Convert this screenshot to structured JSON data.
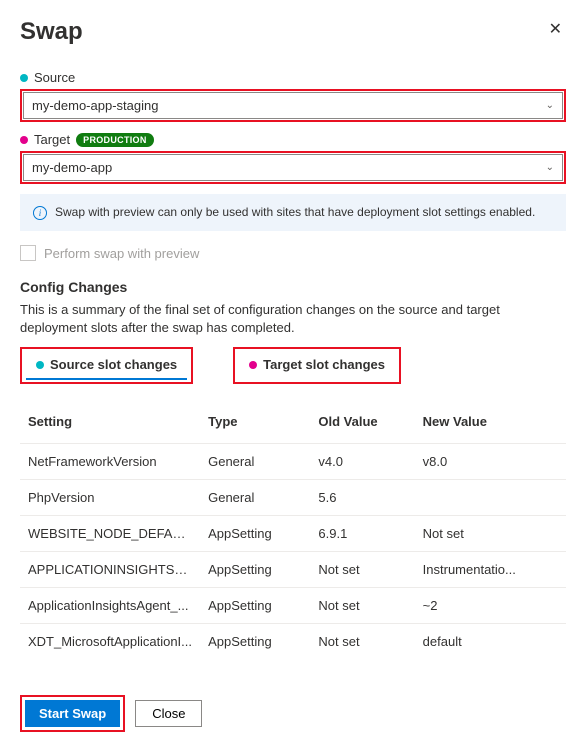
{
  "header": {
    "title": "Swap"
  },
  "source": {
    "label": "Source",
    "value": "my-demo-app-staging"
  },
  "target": {
    "label": "Target",
    "badge": "PRODUCTION",
    "value": "my-demo-app"
  },
  "info": {
    "text": "Swap with preview can only be used with sites that have deployment slot settings enabled."
  },
  "previewCheckbox": {
    "label": "Perform swap with preview"
  },
  "config": {
    "heading": "Config Changes",
    "desc": "This is a summary of the final set of configuration changes on the source and target deployment slots after the swap has completed."
  },
  "tabs": {
    "source": "Source slot changes",
    "target": "Target slot changes"
  },
  "table": {
    "headers": {
      "setting": "Setting",
      "type": "Type",
      "old": "Old Value",
      "new": "New Value"
    },
    "rows": [
      {
        "setting": "NetFrameworkVersion",
        "type": "General",
        "old": "v4.0",
        "new": "v8.0"
      },
      {
        "setting": "PhpVersion",
        "type": "General",
        "old": "5.6",
        "new": ""
      },
      {
        "setting": "WEBSITE_NODE_DEFAULT_...",
        "type": "AppSetting",
        "old": "6.9.1",
        "new": "Not set"
      },
      {
        "setting": "APPLICATIONINSIGHTS_C...",
        "type": "AppSetting",
        "old": "Not set",
        "new": "Instrumentatio..."
      },
      {
        "setting": "ApplicationInsightsAgent_...",
        "type": "AppSetting",
        "old": "Not set",
        "new": "~2"
      },
      {
        "setting": "XDT_MicrosoftApplicationI...",
        "type": "AppSetting",
        "old": "Not set",
        "new": "default"
      }
    ]
  },
  "footer": {
    "start": "Start Swap",
    "close": "Close"
  }
}
